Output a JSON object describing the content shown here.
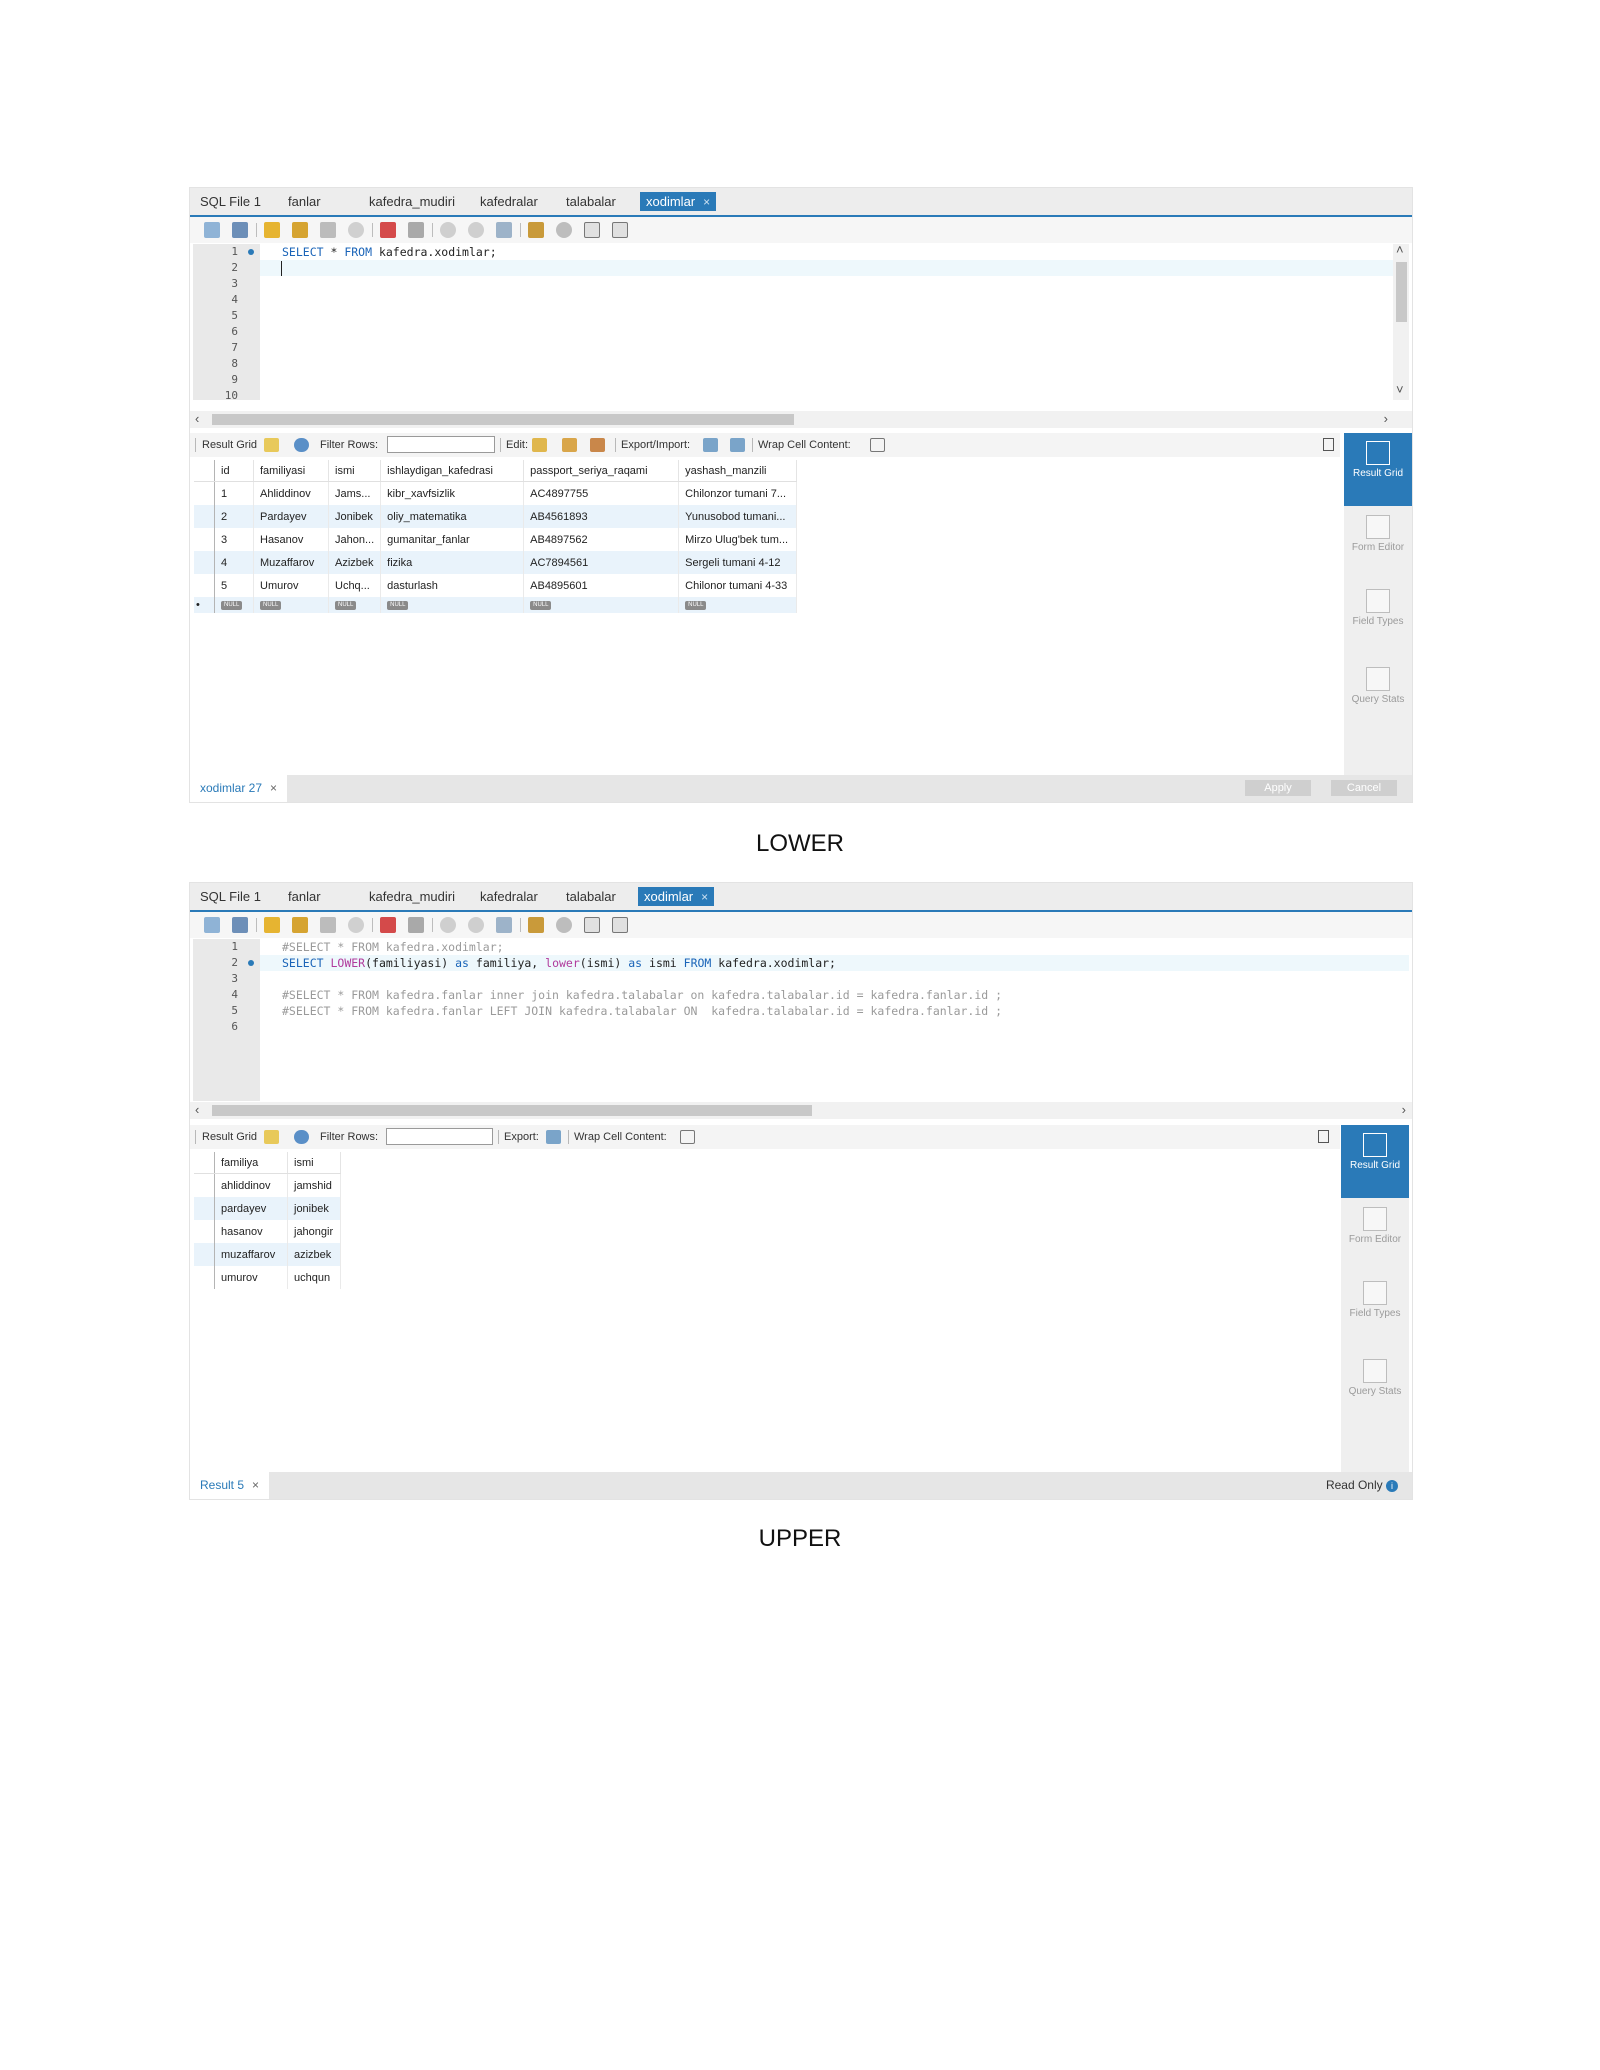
{
  "tabs": [
    "SQL File 1",
    "fanlar",
    "kafedra_mudiri",
    "kafedralar",
    "talabalar",
    "xodimlar"
  ],
  "tab_close": "×",
  "shot1": {
    "line_numbers": [
      "1",
      "2",
      "3",
      "4",
      "5",
      "6",
      "7",
      "8",
      "9",
      "10"
    ],
    "query": {
      "kw1": "SELECT",
      "star": " * ",
      "kw2": "FROM",
      "rest": " kafedra.xodimlar;"
    },
    "toolbar": {
      "result_grid": "Result Grid",
      "filter_rows": "Filter Rows:",
      "edit": "Edit:",
      "export_import": "Export/Import:",
      "wrap_cell": "Wrap Cell Content:"
    },
    "columns": [
      "id",
      "familiyasi",
      "ismi",
      "ishlaydigan_kafedrasi",
      "passport_seriya_raqami",
      "yashash_manzili"
    ],
    "rows": [
      [
        "1",
        "Ahliddinov",
        "Jams...",
        "kibr_xavfsizlik",
        "AC4897755",
        "Chilonzor tumani 7..."
      ],
      [
        "2",
        "Pardayev",
        "Jonibek",
        "oliy_matematika",
        "AB4561893",
        "Yunusobod tumani..."
      ],
      [
        "3",
        "Hasanov",
        "Jahon...",
        "gumanitar_fanlar",
        "AB4897562",
        "Mirzo Ulug'bek tum..."
      ],
      [
        "4",
        "Muzaffarov",
        "Azizbek",
        "fizika",
        "AC7894561",
        "Sergeli tumani 4-12"
      ],
      [
        "5",
        "Umurov",
        "Uchq...",
        "dasturlash",
        "AB4895601",
        "Chilonor tumani 4-33"
      ]
    ],
    "null_label": "NULL",
    "new_row_marker": "•",
    "result_tab": "xodimlar 27",
    "apply": "Apply",
    "cancel": "Cancel"
  },
  "side_panel": {
    "result_grid": "Result Grid",
    "form_editor": "Form Editor",
    "field_types": "Field Types",
    "query_stats": "Query Stats"
  },
  "caption1": "LOWER",
  "shot2": {
    "line_numbers": [
      "1",
      "2",
      "3",
      "4",
      "5",
      "6"
    ],
    "line1": "#SELECT * FROM kafedra.xodimlar;",
    "line2": {
      "a": "SELECT",
      "b": " ",
      "c": "LOWER",
      "d": "(familiyasi) ",
      "e": "as",
      "f": " familiya, ",
      "g": "lower",
      "h": "(ismi) ",
      "i": "as",
      "j": " ismi ",
      "k": "FROM",
      "l": " kafedra.xodimlar;"
    },
    "line4": "#SELECT * FROM kafedra.fanlar inner join kafedra.talabalar on kafedra.talabalar.id = kafedra.fanlar.id ;",
    "line5": "#SELECT * FROM kafedra.fanlar LEFT JOIN kafedra.talabalar ON  kafedra.talabalar.id = kafedra.fanlar.id ;",
    "toolbar": {
      "result_grid": "Result Grid",
      "filter_rows": "Filter Rows:",
      "export": "Export:",
      "wrap_cell": "Wrap Cell Content:"
    },
    "columns": [
      "familiya",
      "ismi"
    ],
    "rows": [
      [
        "ahliddinov",
        "jamshid"
      ],
      [
        "pardayev",
        "jonibek"
      ],
      [
        "hasanov",
        "jahongir"
      ],
      [
        "muzaffarov",
        "azizbek"
      ],
      [
        "umurov",
        "uchqun"
      ]
    ],
    "result_tab": "Result 5",
    "read_only": "Read Only"
  },
  "caption2": "UPPER",
  "colors": {
    "accent": "#2a7ab8",
    "row_alt": "#e9f3fb",
    "keyword": "#1a64b8",
    "function": "#b03a9c",
    "comment": "#9a9a9a"
  }
}
